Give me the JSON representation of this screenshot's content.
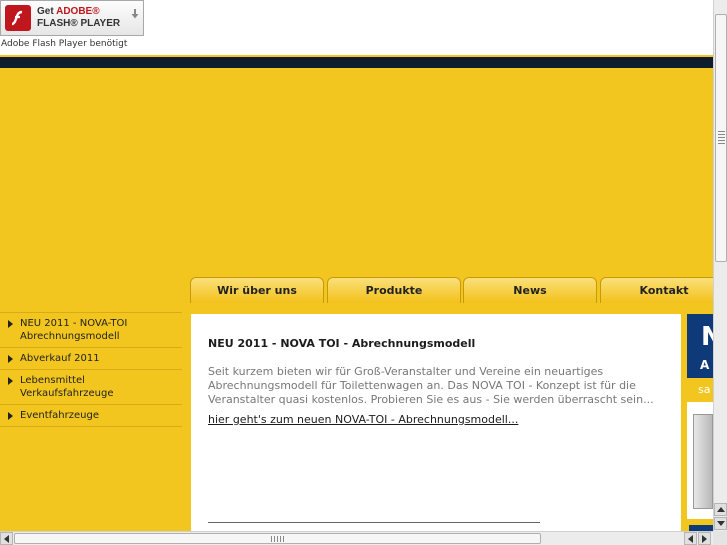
{
  "flash": {
    "get_label": "Get",
    "adobe_label": "ADOBE®",
    "player_label": "FLASH® PLAYER",
    "note": "Adobe Flash Player benötigt"
  },
  "nav": {
    "tabs": [
      {
        "label": "Wir über uns"
      },
      {
        "label": "Produkte"
      },
      {
        "label": "News"
      },
      {
        "label": "Kontakt"
      }
    ]
  },
  "sidebar": {
    "items": [
      {
        "label": "NEU 2011 - NOVA-TOI Abrechnungsmodell"
      },
      {
        "label": "Abverkauf 2011"
      },
      {
        "label": "Lebensmittel Verkaufsfahrzeuge"
      },
      {
        "label": "Eventfahrzeuge"
      }
    ]
  },
  "main": {
    "title": "NEU 2011 - NOVA TOI - Abrechnungsmodell",
    "text": "Seit kurzem bieten wir für Groß-Veranstalter und Vereine ein neuartiges Abrechnungsmodell für Toilettenwagen an. Das NOVA TOI - Konzept ist für die Veranstalter quasi kostenlos. Probieren Sie es aus - Sie werden überrascht sein...",
    "link": "hier geht's zum neuen NOVA-TOI - Abrechnungsmodell..."
  },
  "promo": {
    "letter": "N",
    "sub": "A",
    "band": "sa"
  },
  "colors": {
    "accent_yellow": "#f3c61f",
    "dark_strip": "#0f1c2e",
    "promo_blue": "#0f3a7a",
    "flash_red": "#c0161d"
  }
}
